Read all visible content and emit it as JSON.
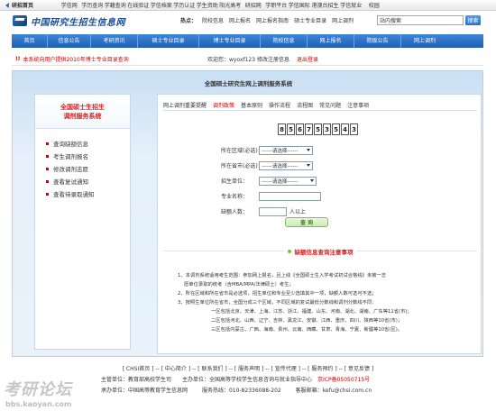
{
  "topbar": {
    "home": "研招首页",
    "links": [
      "学信网",
      "学历查询",
      "学籍查询",
      "在线验证",
      "学信档案",
      "学历认证",
      "学生资助",
      "阳光高考",
      "研招网",
      "学职平台",
      "学信国际",
      "港澳台招生",
      "学信就业",
      "校园"
    ]
  },
  "header": {
    "logo_text": "中国研究生招生信息网",
    "hot_label": "热点：",
    "hot_links": [
      "院校信息",
      "网上报名",
      "网上报名指南",
      "硕士专业目录",
      "网上调剂"
    ],
    "search_placeholder": "站内搜索",
    "search_button": "搜索"
  },
  "nav": [
    "首页",
    "信息公告",
    "考研资讯",
    "硕士专业目录",
    "博士专业目录",
    "院校信息",
    "网上报名",
    "院级公告",
    "网上调剂"
  ],
  "infobar": {
    "mark": "!!",
    "notice": "本系统向用户提供2010年博士专业目录查询",
    "welcome": "欢迎您：wyoxf123",
    "change_password": "修改注册信息",
    "logout": "退出登录"
  },
  "panel_title": "全国硕士研究生网上调剂服务系统",
  "sidebar": {
    "title_line1": "全国硕士生招生",
    "title_line2": "调剂服务系统",
    "items": [
      "查询缺额信息",
      "考生调剂报名",
      "修改调剂志愿",
      "查看复试通知",
      "查看待录取通知"
    ]
  },
  "tabs": [
    "网上调剂重要提醒",
    "调剂政策",
    "基本原则",
    "操作流程",
    "流程图",
    "常见问题",
    "注意事项"
  ],
  "captcha": [
    "8",
    "5",
    "6",
    "7",
    "5",
    "3",
    "5",
    "4",
    "3"
  ],
  "form": {
    "region_label": "所在区域(必选)：",
    "region_value": "------请选择------",
    "province_label": "所在省市(必选)：",
    "province_value": "------请选择------",
    "unit_label": "招生单位：",
    "unit_value": "------请选择------",
    "major_label": "专业名称：",
    "count_label": "缺额人数：",
    "count_unit": "人以上",
    "query_button": "查 询"
  },
  "notes": {
    "title": "缺额信息查询注意事项",
    "lines": [
      "1、本调剂系统适用考生范围：参加网上报名，且上线《全国硕士生入学考试初试合格线》未被一志",
      "愿单位录取的统考（含MBA/MPA/法律硕士）考生；",
      "2、所在区域和所在省市是必选项，招生单位和专业至少选填其中一项，缺额人数可选可不选；",
      "3、按照生单位所在省市，全国分成三个区域，不同区域的复试最低分数线和调剂分数线不同：",
      "一区包括北京、天津、上海、江苏、浙江、福建、山东、河南、湖北、湖南、广东等11省(市)；",
      "二区包括河北、山西、辽宁、吉林、黑龙江、安徽、江西、重庆、四川、陕西等10省(市)；",
      "三区包括内蒙古、广西、海南、贵州、云南、西藏、甘肃、青海、宁夏、新疆等10省(区)。"
    ]
  },
  "footer": {
    "links": "[ CHSI首页 ] -- [ 中心简介 ] -- [ 联系我们 ] -- [ 服务声明 ] -- [ 宣传代理 ] -- [ 服务预约 ] -- [ 意见反馈 ]",
    "sponsor": "主管单位：教育部高校学生司　　主办单位：全国高等学校学生信息咨询与就业指导中心　",
    "icp": "京ICP备05050715号",
    "org": "承办单位：中国高等教育学生信息网",
    "phone": "服务热线：010-82336088-202",
    "email": "客服邮箱：kefu@chsi.com.cn"
  },
  "watermark": {
    "text": "考研论坛",
    "url": "bbs.kaoyan.com"
  }
}
